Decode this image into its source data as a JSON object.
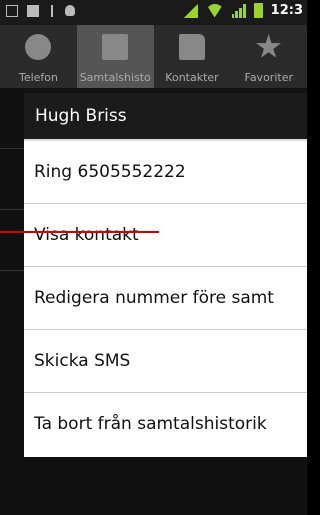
{
  "status_bar": {
    "time": "12:3"
  },
  "tabs": [
    {
      "label": "Telefon",
      "icon": "phone-icon"
    },
    {
      "label": "Samtalshisto",
      "icon": "call-log-icon"
    },
    {
      "label": "Kontakter",
      "icon": "contacts-icon"
    },
    {
      "label": "Favoriter",
      "icon": "star-icon"
    }
  ],
  "dialog": {
    "title": "Hugh Briss",
    "items": [
      "Ring 6505552222",
      "Visa kontakt",
      "Redigera nummer före samt",
      "Skicka SMS",
      "Ta bort från samtalshistorik"
    ]
  },
  "colors": {
    "accent": "#d00000",
    "signal": "#9ad32b"
  }
}
